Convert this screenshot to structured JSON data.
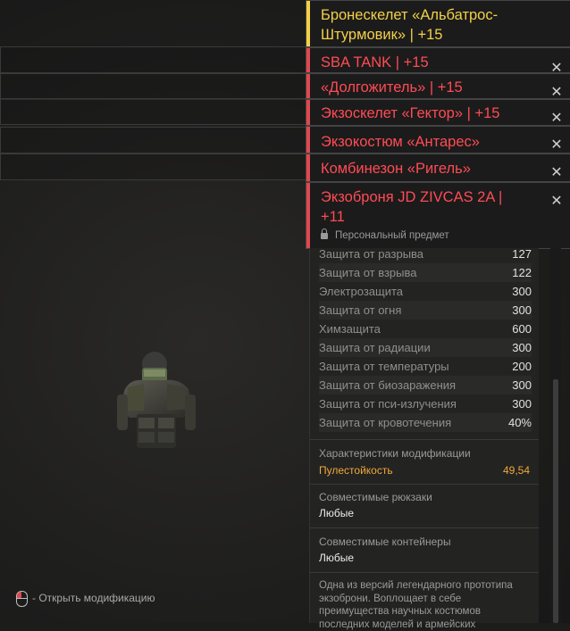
{
  "tooltips": [
    {
      "title": "Бронескелет «Альбатрос-Штурмовик» | +15",
      "accent": "#f2d048"
    },
    {
      "title": "SBA TANK | +15",
      "accent": "#e0484f"
    },
    {
      "title": "«Долгожитель» | +15",
      "accent": "#e0484f"
    },
    {
      "title": "Экзоскелет «Гектор» | +15",
      "accent": "#e0484f"
    },
    {
      "title": "Экзокостюм «Антарес»",
      "accent": "#e0484f"
    },
    {
      "title": "Комбинезон «Ригель»",
      "accent": "#e0484f"
    },
    {
      "title": "Экзоброня JD ZIVCAS 2A | +11",
      "accent": "#e0484f"
    }
  ],
  "close_glyph": "✕",
  "private_item": "Персональный предмет",
  "stats": [
    {
      "label": "Защита от разрыва",
      "value": "127"
    },
    {
      "label": "Защита от взрыва",
      "value": "122"
    },
    {
      "label": "Электрозащита",
      "value": "300"
    },
    {
      "label": "Защита от огня",
      "value": "300"
    },
    {
      "label": "Химзащита",
      "value": "600"
    },
    {
      "label": "Защита от радиации",
      "value": "300"
    },
    {
      "label": "Защита от температуры",
      "value": "200"
    },
    {
      "label": "Защита от биозаражения",
      "value": "300"
    },
    {
      "label": "Защита от пси-излучения",
      "value": "300"
    },
    {
      "label": "Защита от кровотечения",
      "value": "40%"
    }
  ],
  "modification": {
    "title": "Характеристики модификации",
    "label": "Пулестойкость",
    "value": "49,54"
  },
  "backpacks": {
    "title": "Совместимые рюкзаки",
    "value": "Любые"
  },
  "containers": {
    "title": "Совместимые контейнеры",
    "value": "Любые"
  },
  "description": "Одна из версий легендарного прототипа экзоброни. Воплощает в себе преимущества научных костюмов последних моделей и армейских",
  "hint": "- Открыть модификацию",
  "colors": {
    "accent_red": "#e0484f",
    "accent_gold": "#f2d048",
    "mod_orange": "#f0a83a"
  }
}
